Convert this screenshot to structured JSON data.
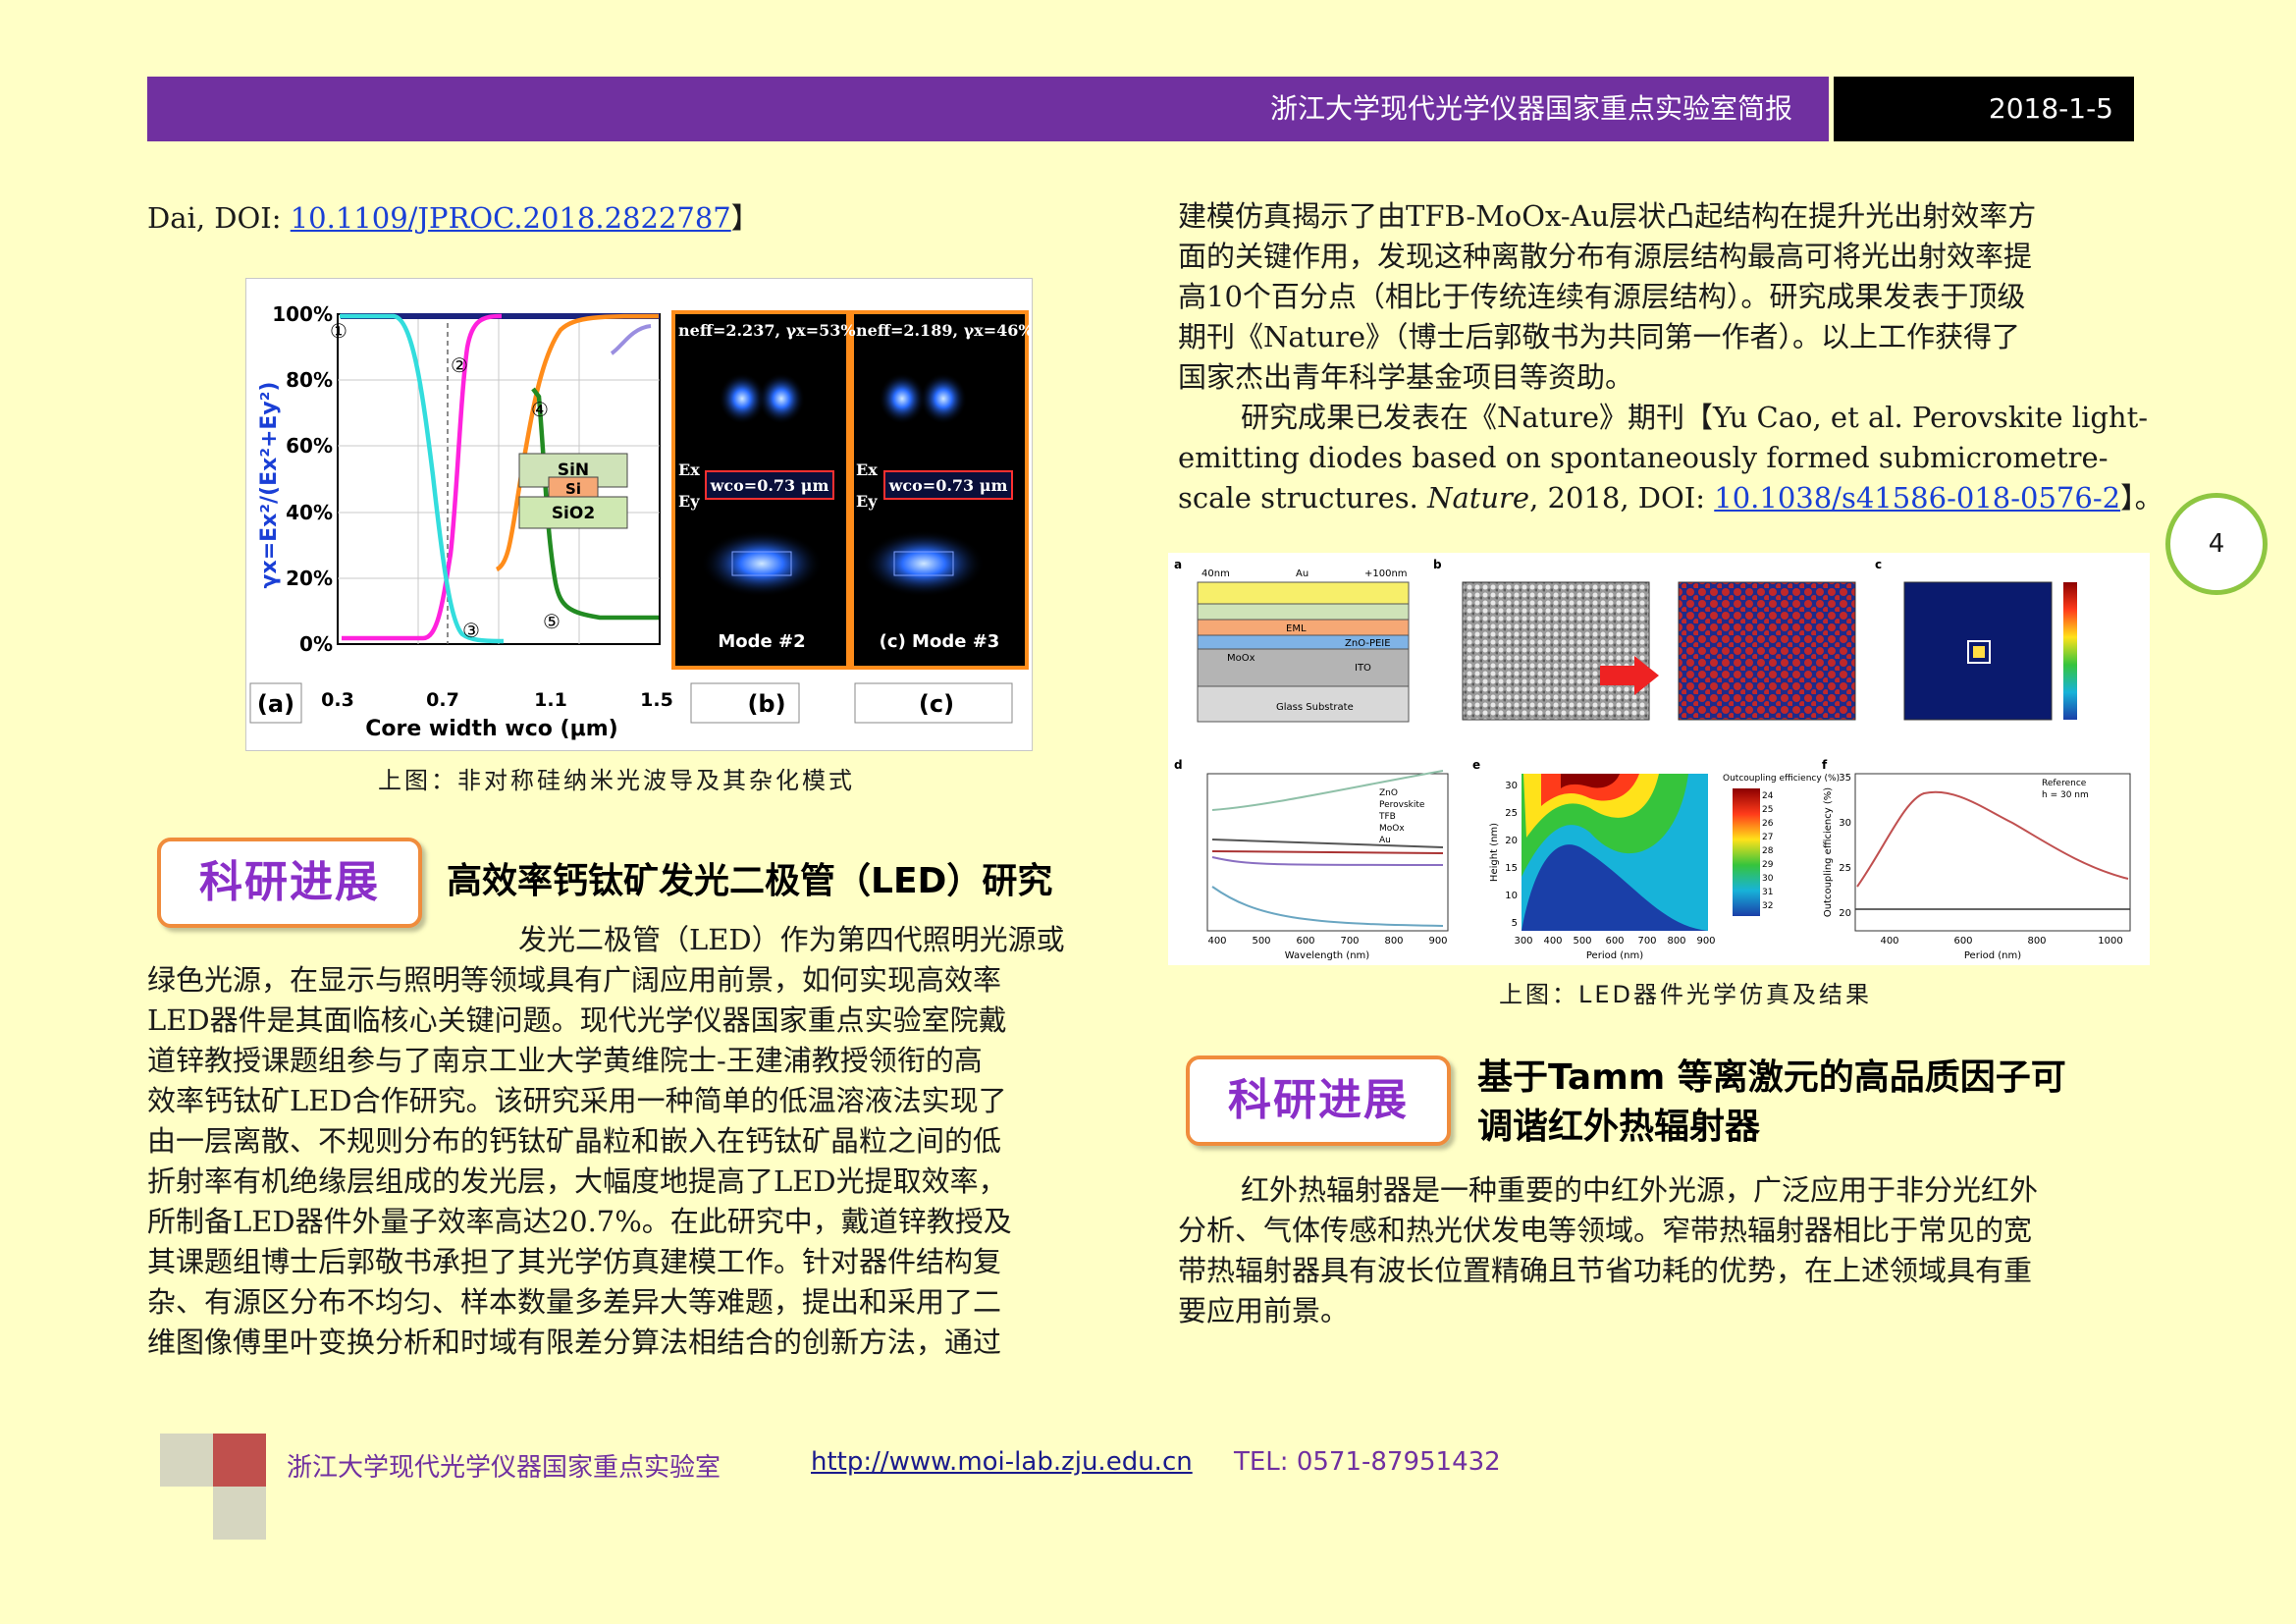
{
  "header": {
    "title": "浙江大学现代光学仪器国家重点实验室简报",
    "date": "2018-1-5"
  },
  "page_number": "4",
  "left_top": {
    "prefix": "Dai, DOI: ",
    "doi": "10.1109/JPROC.2018.2822787",
    "suffix": "】"
  },
  "fig1": {
    "caption": "上图：非对称硅纳米光波导及其杂化模式",
    "ylabel": "γx=Ex²/(Ex²+Ey²)",
    "yticks": [
      "100%",
      "80%",
      "60%",
      "40%",
      "20%",
      "0%"
    ],
    "xticks": [
      "0.3",
      "0.7",
      "1.1",
      "1.5"
    ],
    "xlabel": "Core width wco (μm)",
    "panel_a": "(a)",
    "panel_b": "(b)",
    "panel_c": "(c)",
    "markers": [
      "①",
      "②",
      "③",
      "④",
      "⑤"
    ],
    "layers": [
      "SiN",
      "Si",
      "SiO2"
    ],
    "mode_b": {
      "neff": "neff=2.237, γx=53%",
      "w": "wco=0.73 μm",
      "ex": "Ex",
      "ey": "Ey",
      "label": "Mode #2"
    },
    "mode_c": {
      "neff": "neff=2.189, γx=46%",
      "w": "wco=0.73 μm",
      "ex": "Ex",
      "ey": "Ey",
      "label": "(c) Mode #3"
    },
    "colors": {
      "magenta": "#ff22dd",
      "cyan": "#33dddd",
      "orange": "#ff8c1a",
      "green": "#228b22",
      "navy": "#1a237e",
      "lavender": "#9a8ee0"
    }
  },
  "sec1": {
    "badge": "科研进展",
    "title": "高效率钙钛矿发光二极管（LED）研究",
    "lines": [
      "发光二极管（LED）作为第四代照明光源或",
      "绿色光源，在显示与照明等领域具有广阔应用前景，如何实现高效率",
      "LED器件是其面临核心关键问题。现代光学仪器国家重点实验室院戴",
      "道锌教授课题组参与了南京工业大学黄维院士-王建浦教授领衔的高",
      "效率钙钛矿LED合作研究。该研究采用一种简单的低温溶液法实现了",
      "由一层离散、不规则分布的钙钛矿晶粒和嵌入在钙钛矿晶粒之间的低",
      "折射率有机绝缘层组成的发光层，大幅度地提高了LED光提取效率，",
      "所制备LED器件外量子效率高达20.7%。在此研究中，戴道锌教授及",
      "其课题组博士后郭敬书承担了其光学仿真建模工作。针对器件结构复",
      "杂、有源区分布不均匀、样本数量多差异大等难题，提出和采用了二",
      "维图像傅里叶变换分析和时域有限差分算法相结合的创新方法，通过"
    ]
  },
  "right_top": {
    "lines": [
      "建模仿真揭示了由TFB-MoOx-Au层状凸起结构在提升光出射效率方",
      "面的关键作用，发现这种离散分布有源层结构最高可将光出射效率提",
      "高10个百分点（相比于传统连续有源层结构）。研究成果发表于顶级",
      "期刊《Nature》（博士后郭敬书为共同第一作者）。以上工作获得了",
      "国家杰出青年科学基金项目等资助。"
    ],
    "ref_line1": "研究成果已发表在《Nature》期刊【Yu Cao, et al. Perovskite light-",
    "ref_line2": "emitting diodes based on spontaneously formed submicrometre-",
    "ref_line3_a": "scale structures. ",
    "ref_line3_b": "Nature",
    "ref_line3_c": ", 2018, DOI: ",
    "ref_doi": "10.1038/s41586-018-0576-2",
    "ref_end": "】。"
  },
  "fig2": {
    "caption": "上图：LED器件光学仿真及结果",
    "panels": [
      "a",
      "b",
      "c",
      "d",
      "e",
      "f"
    ],
    "a_labels": [
      "40nm",
      "Au",
      "+100nm",
      "EML",
      "ZnO-PEIE",
      "MoOx",
      "ITO",
      "Glass Substrate"
    ],
    "d_legend": [
      "ZnO",
      "Perovskite",
      "TFB",
      "MoOx",
      "Au"
    ],
    "d_xlabel": "Wavelength (nm)",
    "d_xticks": [
      "400",
      "500",
      "600",
      "700",
      "800",
      "900"
    ],
    "e_title": "Outcoupling efficiency (%)",
    "e_xlabel": "Period (nm)",
    "e_ylabel": "Height (nm)",
    "e_xticks": [
      "300",
      "400",
      "500",
      "600",
      "700",
      "800",
      "900"
    ],
    "e_yticks": [
      "30",
      "25",
      "20",
      "15",
      "10",
      "5"
    ],
    "e_scale": [
      "24",
      "25",
      "26",
      "27",
      "28",
      "29",
      "30",
      "31",
      "32"
    ],
    "f_legend": [
      "Reference",
      "h = 30 nm"
    ],
    "f_xlabel": "Period (nm)",
    "f_ylabel": "Outcoupling efficiency (%)",
    "f_xticks": [
      "400",
      "600",
      "800",
      "1000"
    ],
    "f_yticks": [
      "35",
      "30",
      "25",
      "20"
    ]
  },
  "sec2": {
    "badge": "科研进展",
    "title_line1": "基于Tamm 等离激元的高品质因子可",
    "title_line2": "调谐红外热辐射器",
    "lines": [
      "红外热辐射器是一种重要的中红外光源，广泛应用于非分光红外",
      "分析、气体传感和热光伏发电等领域。窄带热辐射器相比于常见的宽",
      "带热辐射器具有波长位置精确且节省功耗的优势，在上述领域具有重",
      "要应用前景。"
    ]
  },
  "footer": {
    "lab": "浙江大学现代光学仪器国家重点实验室",
    "url": "http://www.moi-lab.zju.edu.cn",
    "tel": "TEL: 0571-87951432"
  }
}
